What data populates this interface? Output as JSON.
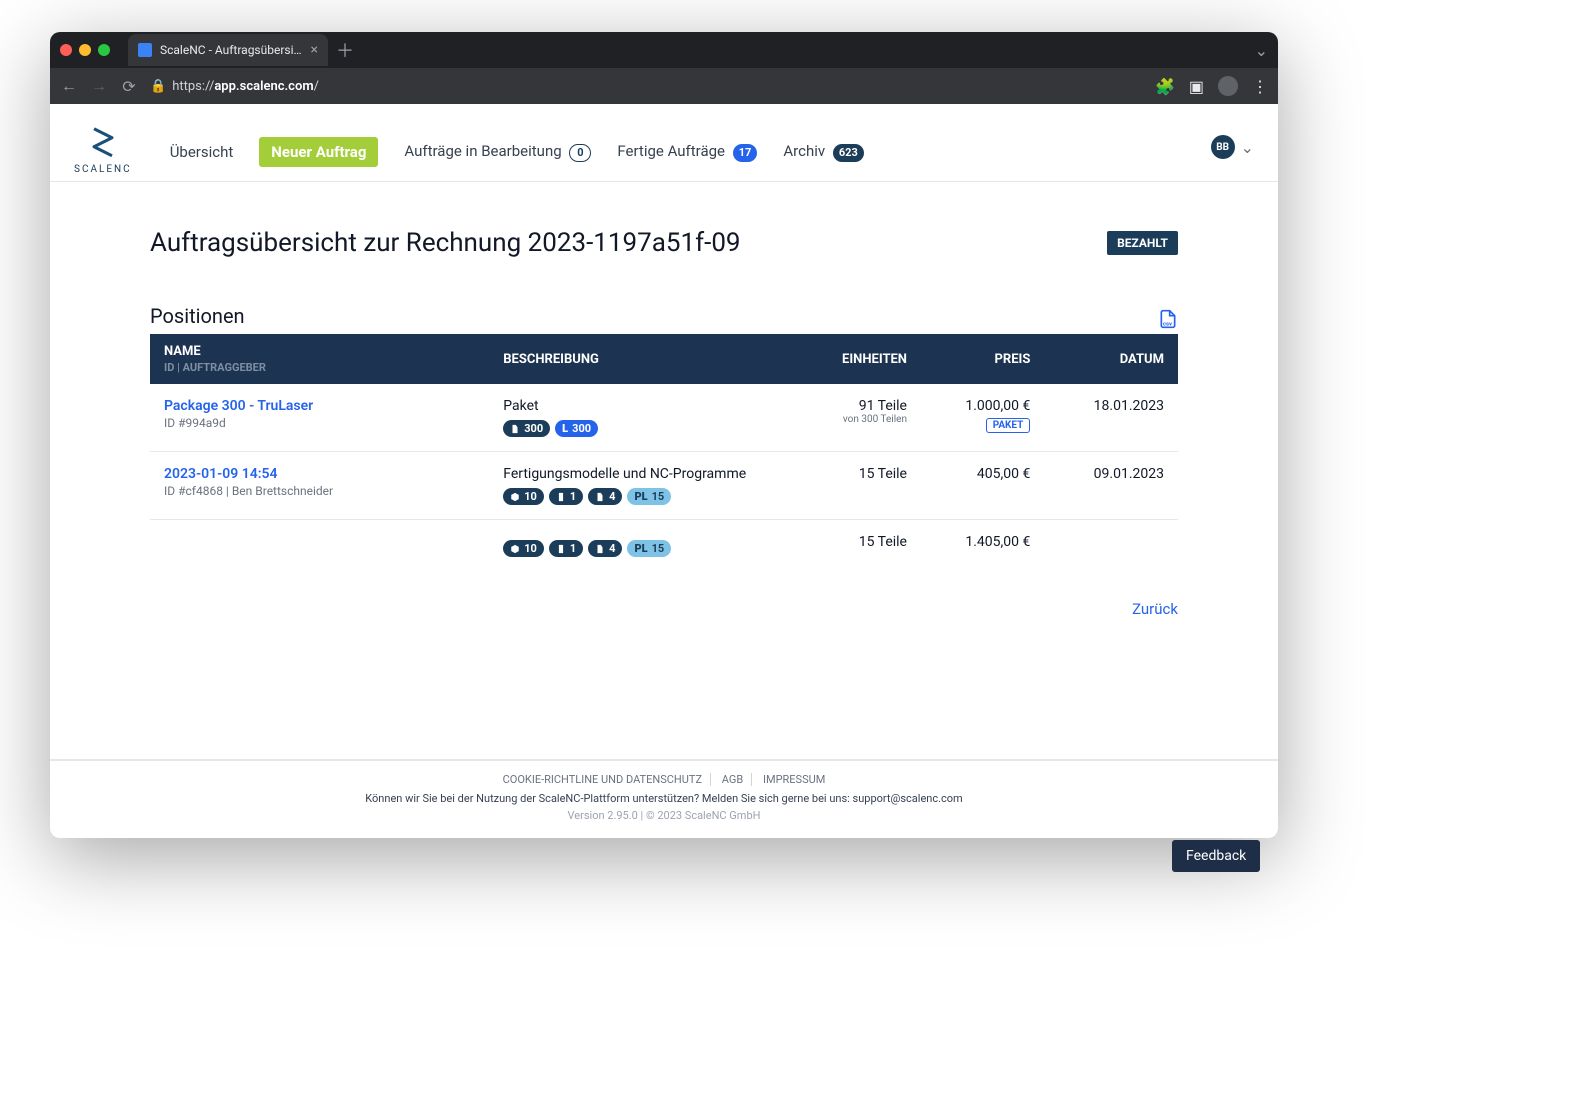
{
  "browser": {
    "tab_title": "ScaleNC - Auftragsübersicht zu",
    "url_scheme": "https://",
    "url_host": "app.scalenc.com",
    "url_path": "/"
  },
  "header": {
    "brand": "SCALENC",
    "nav": {
      "overview": "Übersicht",
      "new_order": "Neuer Auftrag",
      "in_progress": "Aufträge in Bearbeitung",
      "in_progress_count": "0",
      "done": "Fertige Aufträge",
      "done_count": "17",
      "archive": "Archiv",
      "archive_count": "623"
    },
    "user_initials": "BB"
  },
  "page": {
    "title": "Auftragsübersicht zur Rechnung 2023-1197a51f-09",
    "status": "BEZAHLT",
    "section": "Positionen",
    "columns": {
      "name": "NAME",
      "name_sub": "ID | AUFTRAGGEBER",
      "desc": "BESCHREIBUNG",
      "units": "EINHEITEN",
      "price": "PREIS",
      "date": "DATUM"
    },
    "rows": [
      {
        "name": "Package 300 - TruLaser",
        "sub": "ID #994a9d",
        "desc": "Paket",
        "chips": [
          {
            "cls": "c-navy",
            "icon": "doc",
            "val": "300"
          },
          {
            "cls": "c-blue",
            "icon": "L",
            "val": "300"
          }
        ],
        "units": "91 Teile",
        "units_sub": "von 300 Teilen",
        "price": "1.000,00 €",
        "price_tag": "PAKET",
        "date": "18.01.2023"
      },
      {
        "name": "2023-01-09 14:54",
        "sub": "ID #cf4868 | Ben Brettschneider",
        "desc": "Fertigungsmodelle und NC-Programme",
        "chips": [
          {
            "cls": "c-navy",
            "icon": "cube",
            "val": "10"
          },
          {
            "cls": "c-navy",
            "icon": "bolt",
            "val": "1"
          },
          {
            "cls": "c-navy",
            "icon": "doc",
            "val": "4"
          },
          {
            "cls": "c-sky",
            "icon": "PL",
            "val": "15"
          }
        ],
        "units": "15 Teile",
        "units_sub": "",
        "price": "405,00 €",
        "price_tag": "",
        "date": "09.01.2023"
      }
    ],
    "totals": {
      "chips": [
        {
          "cls": "c-navy",
          "icon": "cube",
          "val": "10"
        },
        {
          "cls": "c-navy",
          "icon": "bolt",
          "val": "1"
        },
        {
          "cls": "c-navy",
          "icon": "doc",
          "val": "4"
        },
        {
          "cls": "c-sky",
          "icon": "PL",
          "val": "15"
        }
      ],
      "units": "15 Teile",
      "price": "1.405,00 €"
    },
    "back": "Zurück"
  },
  "footer": {
    "cookie": "COOKIE-RICHTLINE UND DATENSCHUTZ",
    "agb": "AGB",
    "impressum": "IMPRESSUM",
    "support": "Können wir Sie bei der Nutzung der ScaleNC-Plattform unterstützen? Melden Sie sich gerne bei uns: support@scalenc.com",
    "version": "Version 2.95.0 | © 2023 ScaleNC GmbH"
  },
  "feedback": "Feedback"
}
